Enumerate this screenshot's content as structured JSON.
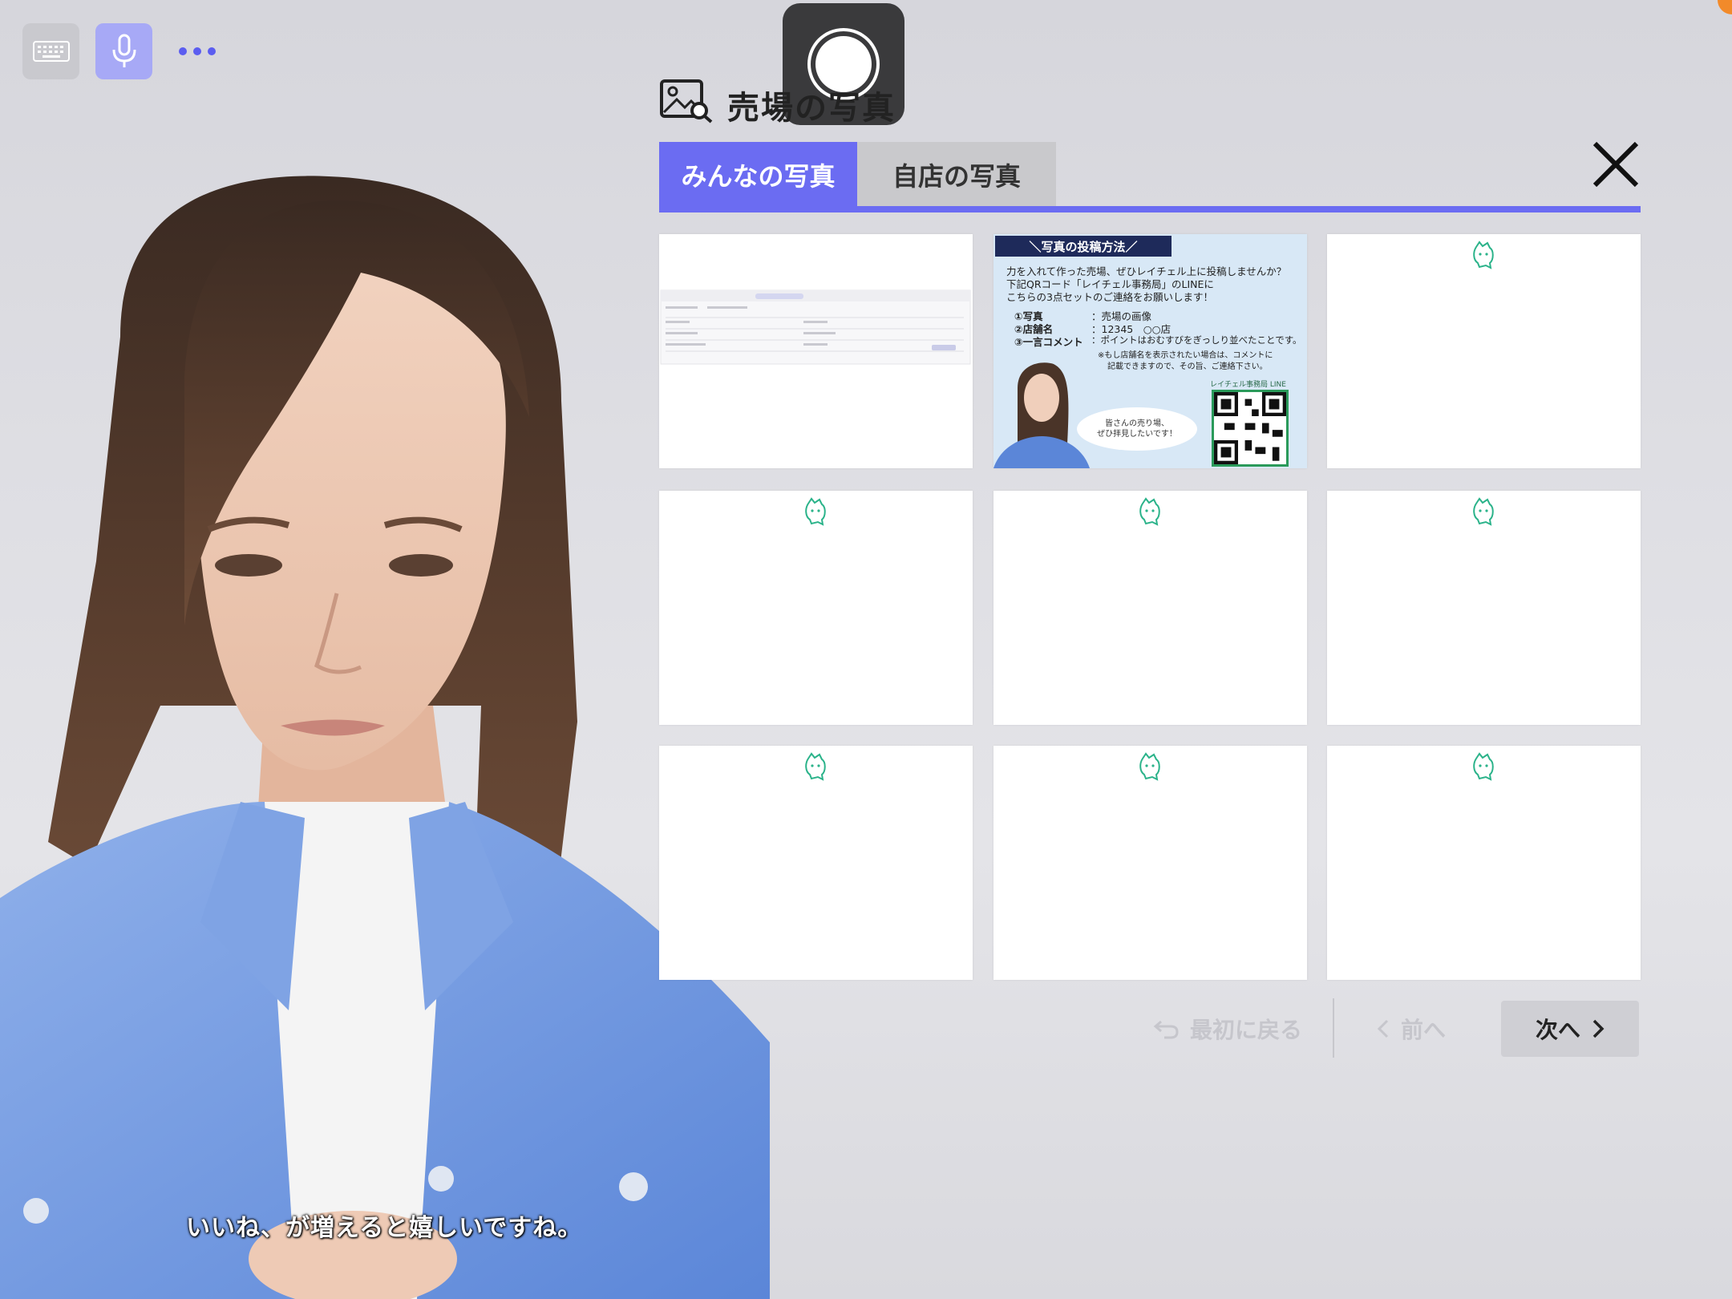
{
  "toolbar": {
    "keyboard_icon": "keyboard-icon",
    "mic_icon": "microphone-icon",
    "more_icon": "more-dots-icon",
    "record_icon": "record-icon"
  },
  "panel": {
    "title": "売場の写真",
    "title_icon": "image-search-icon",
    "close_icon": "close-icon",
    "tabs": [
      {
        "label": "みんなの写真",
        "active": true
      },
      {
        "label": "自店の写真",
        "active": false
      }
    ],
    "accent_color": "#6b6cf2"
  },
  "info_card": {
    "header": "＼写真の投稿方法／",
    "line1": "力を入れて作った売場、ぜひレイチェル上に投稿しませんか？",
    "line2": "下記QRコード「レイチェル事務局」のLINEに",
    "line3": "こちらの3点セットのご連絡をお願いします！",
    "item1_label": "①写真",
    "item1_value": "：売場の画像",
    "item2_label": "②店舗名",
    "item2_value": "：12345　○○店",
    "item3_label": "③一言コメント",
    "item3_value": "：ポイントはおむすびをぎっしり並べたことです。",
    "note1": "※もし店舗名を表示されたい場合は、コメントに",
    "note2": "記載できますので、その旨、ご連絡下さい。",
    "bubble1": "皆さんの売り場、",
    "bubble2": "ぜひ拝見したいです！",
    "qr_caption": "レイチェル事務局 LINE"
  },
  "nav": {
    "first_label": "最初に戻る",
    "prev_label": "前へ",
    "next_label": "次へ",
    "first_icon": "return-icon",
    "prev_icon": "chevron-left-icon",
    "next_icon": "chevron-right-icon"
  },
  "subtitle": "いいね、が増えると嬉しいですね。"
}
